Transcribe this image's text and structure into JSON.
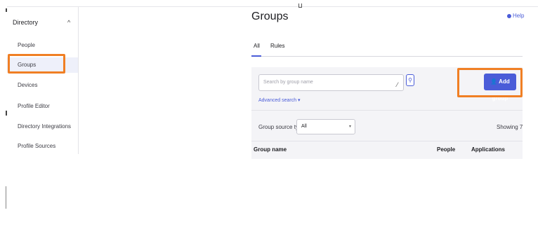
{
  "sidebar": {
    "section_label": "Directory",
    "collapse_caret": "^",
    "items": [
      {
        "label": "People"
      },
      {
        "label": "Groups"
      },
      {
        "label": "Devices"
      },
      {
        "label": "Profile Editor"
      },
      {
        "label": "Directory Integrations"
      },
      {
        "label": "Profile Sources"
      }
    ]
  },
  "main": {
    "title": "Groups",
    "help_label": "Help",
    "tabs": [
      {
        "label": "All"
      },
      {
        "label": "Rules"
      }
    ],
    "search": {
      "placeholder": "Search by group name",
      "advanced_link": "Advanced search"
    },
    "add_group_label": "Add group",
    "filter": {
      "label": "Group source type",
      "value": "All"
    },
    "showing_text": "Showing 7",
    "columns": [
      "Group name",
      "People",
      "Applications"
    ]
  },
  "colors": {
    "accent": "#4a5cd8",
    "highlight": "#f07f24"
  }
}
